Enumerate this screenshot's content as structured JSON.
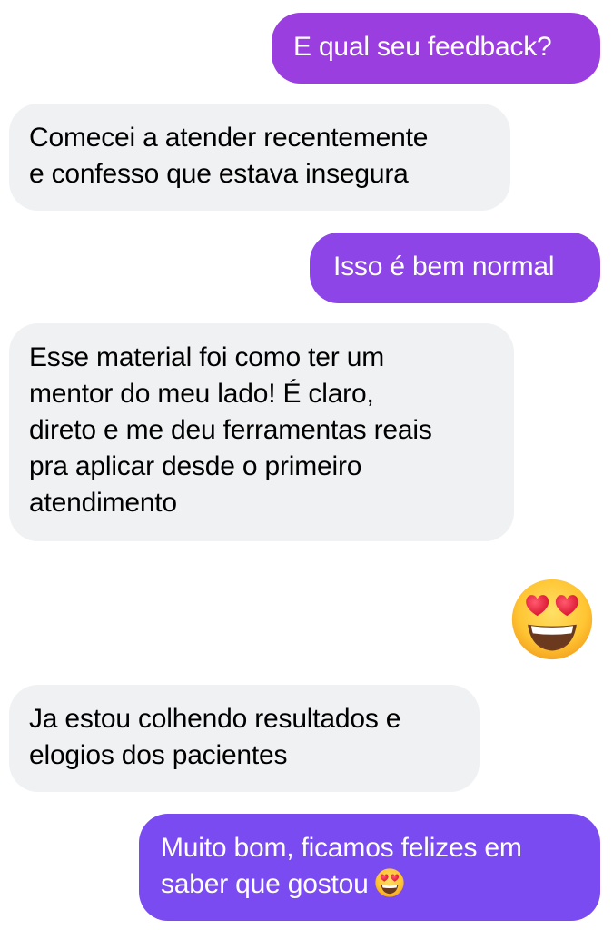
{
  "chat": {
    "messages": [
      {
        "sender": "me",
        "lines": [
          "E qual seu feedback?"
        ]
      },
      {
        "sender": "contact",
        "lines": [
          "Comecei a atender recentemente",
          "e confesso que estava insegura"
        ]
      },
      {
        "sender": "me",
        "lines": [
          "Isso é bem normal"
        ]
      },
      {
        "sender": "contact",
        "lines": [
          "Esse material foi como ter um",
          "mentor do meu lado! É claro,",
          "direto e me deu ferramentas reais",
          "pra aplicar desde o primeiro",
          "atendimento"
        ]
      },
      {
        "sender": "me",
        "emoji": "heart-eyes-emoji"
      },
      {
        "sender": "contact",
        "lines": [
          "Ja estou colhendo resultados e",
          "elogios dos pacientes"
        ]
      },
      {
        "sender": "me",
        "lines": [
          "Muito bom, ficamos felizes em",
          "saber que gostou"
        ],
        "trailing_emoji": "heart-eyes-emoji"
      }
    ]
  },
  "colors": {
    "incoming_bubble": "#eff1f3",
    "outgoing_top": "#9b3ee0",
    "outgoing_middle": "#8e45e8",
    "outgoing_bottom": "#7a4bf0",
    "emoji_face": "#ffcb3d",
    "emoji_heart": "#f0243c"
  }
}
